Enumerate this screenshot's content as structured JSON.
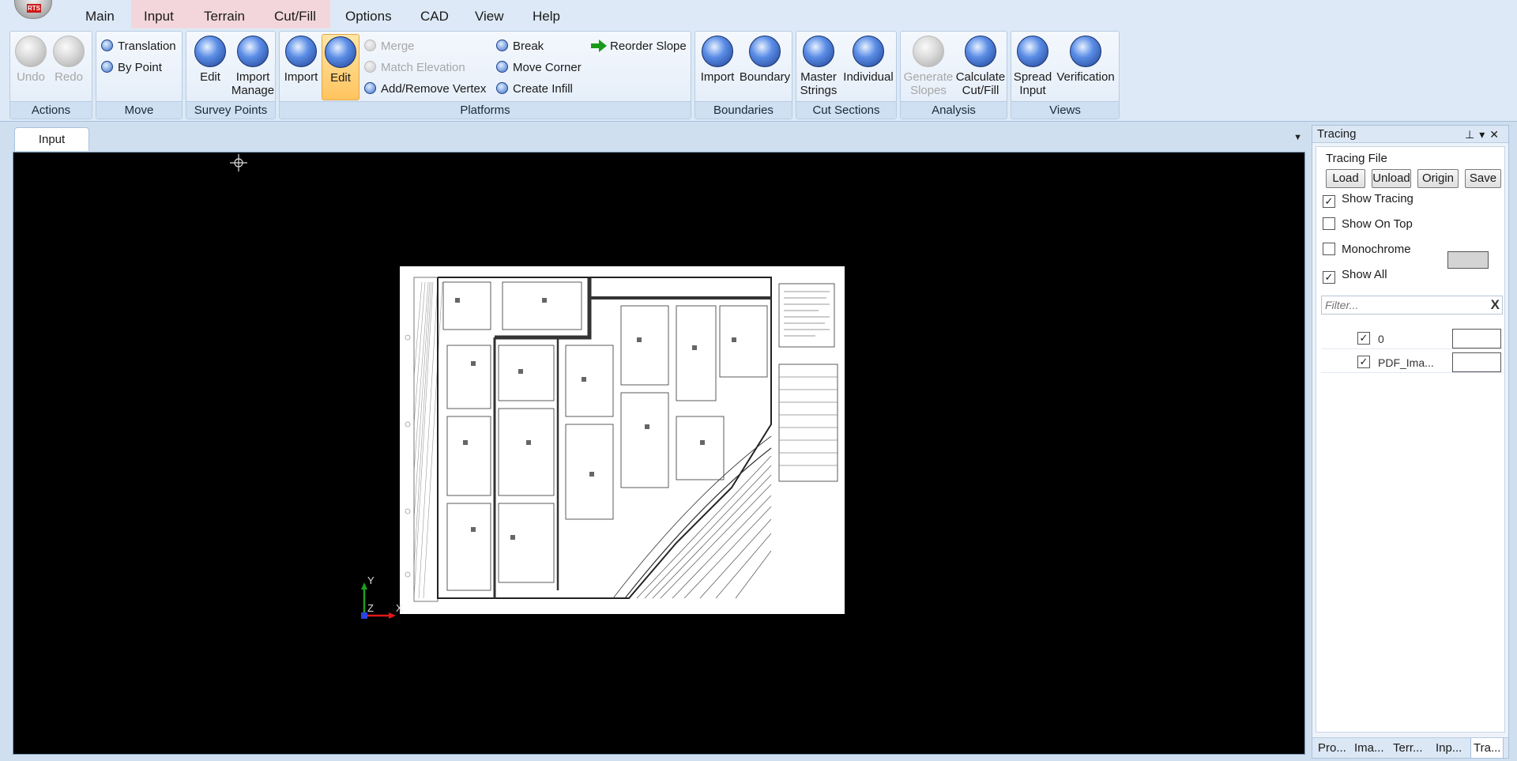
{
  "menu": {
    "logo_text": "RTS",
    "items": [
      "Main",
      "Input",
      "Terrain",
      "Cut/Fill",
      "Options",
      "CAD",
      "View",
      "Help"
    ]
  },
  "ribbon": {
    "actions": {
      "label": "Actions",
      "undo": "Undo",
      "redo": "Redo"
    },
    "move": {
      "label": "Move",
      "translation": "Translation",
      "by_point": "By Point"
    },
    "survey_points": {
      "label": "Survey Points",
      "edit": "Edit",
      "import_manage_1": "Import",
      "import_manage_2": "Manage"
    },
    "platforms": {
      "label": "Platforms",
      "import": "Import",
      "edit": "Edit",
      "merge": "Merge",
      "match_elevation": "Match Elevation",
      "add_remove_vertex": "Add/Remove Vertex",
      "break": "Break",
      "move_corner": "Move Corner",
      "create_infill": "Create Infill",
      "reorder_slope": "Reorder Slope"
    },
    "boundaries": {
      "label": "Boundaries",
      "import": "Import",
      "boundary": "Boundary"
    },
    "cut_sections": {
      "label": "Cut Sections",
      "master_1": "Master",
      "master_2": "Strings",
      "individual": "Individual"
    },
    "analysis": {
      "label": "Analysis",
      "gen_1": "Generate",
      "gen_2": "Slopes",
      "calc_1": "Calculate",
      "calc_2": "Cut/Fill"
    },
    "views": {
      "label": "Views",
      "spread_1": "Spread",
      "spread_2": "Input",
      "verification": "Verification"
    }
  },
  "document": {
    "tab": "Input"
  },
  "panel": {
    "title": "Tracing",
    "section": "Tracing File",
    "buttons": {
      "load": "Load",
      "unload": "Unload",
      "origin": "Origin",
      "save": "Save"
    },
    "options": [
      {
        "label": "Show Tracing",
        "checked": true
      },
      {
        "label": "Show On Top",
        "checked": false
      },
      {
        "label": "Monochrome",
        "checked": false
      },
      {
        "label": "Show All",
        "checked": true
      }
    ],
    "monochrome_color": "#d4d4d4",
    "filter_placeholder": "Filter...",
    "filter_clear": "X",
    "layers": [
      {
        "name": "0",
        "checked": true
      },
      {
        "name": "PDF_Ima...",
        "checked": true
      }
    ],
    "tabs": [
      "Pro...",
      "Ima...",
      "Terr...",
      "Inp...",
      "Tra..."
    ]
  },
  "axes": {
    "y": "Y",
    "z": "Z",
    "x": "X"
  },
  "colors": {
    "accent": "#ffc45e",
    "viewport_bg": "#000000",
    "ribbon_bg": "#dde9f6",
    "context_tab": "#f2d6dc"
  }
}
